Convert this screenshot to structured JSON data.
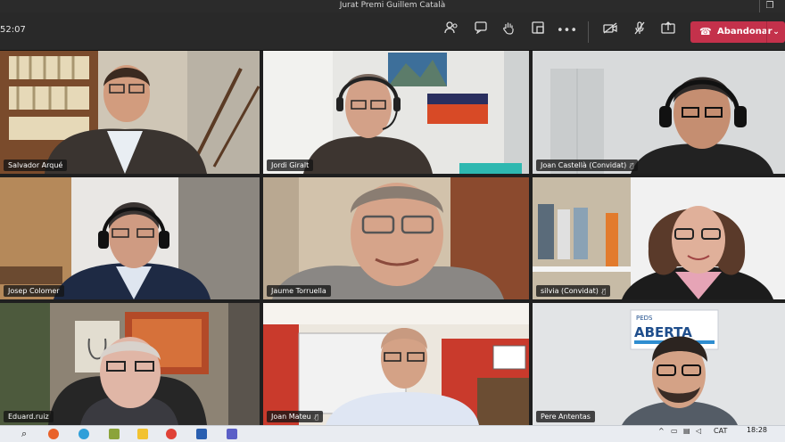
{
  "window": {
    "title": "Jurat Premi Guillem Català"
  },
  "meeting": {
    "elapsed": "52:07",
    "leave_label": "Abandonar"
  },
  "participants": [
    {
      "name": "Salvador Arqué",
      "muted": false
    },
    {
      "name": "Jordi Giralt",
      "muted": false
    },
    {
      "name": "Joan Castellà (Convidat)",
      "muted": true
    },
    {
      "name": "Josep Colomer",
      "muted": false
    },
    {
      "name": "Jaume Torruella",
      "muted": false
    },
    {
      "name": "silvia (Convidat)",
      "muted": true
    },
    {
      "name": "Eduard.ruiz",
      "muted": false
    },
    {
      "name": "Joan Mateu",
      "muted": true
    },
    {
      "name": "Pere Antentas",
      "muted": false
    }
  ],
  "poster_text": {
    "line1": "PEDS",
    "line2": "ABERTA"
  },
  "taskbar": {
    "time": "18:28",
    "language": "CAT"
  },
  "colors": {
    "leave": "#c4314b",
    "toolbar": "#292929",
    "grid_bg": "#1f1f1f"
  }
}
